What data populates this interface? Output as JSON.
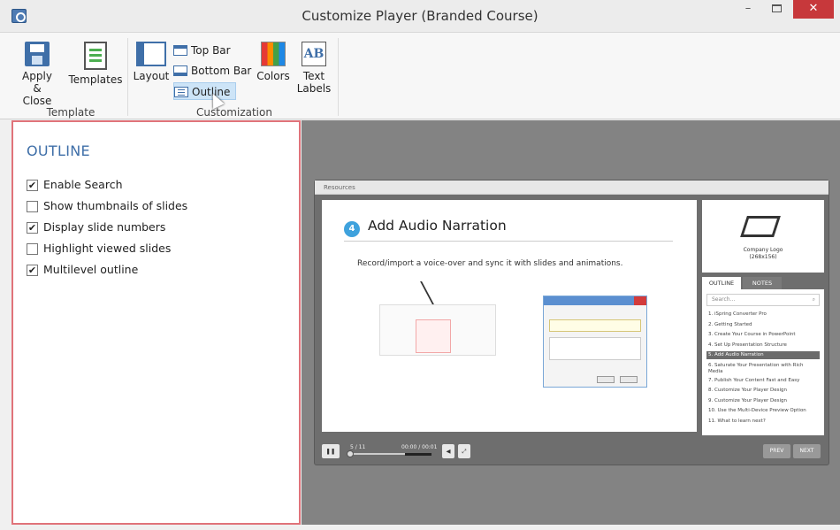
{
  "window": {
    "title": "Customize Player (Branded Course)",
    "minimize_glyph": "–",
    "close_glyph": "✕"
  },
  "ribbon": {
    "apply_close_label": "Apply\n& Close",
    "templates_label": "Templates",
    "layout_label": "Layout",
    "top_bar_label": "Top Bar",
    "bottom_bar_label": "Bottom Bar",
    "outline_label": "Outline",
    "colors_label": "Colors",
    "text_labels_label": "Text\nLabels",
    "text_labels_icon_text": "AB",
    "group_template": "Template",
    "group_customization": "Customization"
  },
  "panel": {
    "title": "OUTLINE",
    "options": [
      {
        "label": "Enable Search",
        "checked": true
      },
      {
        "label": "Show thumbnails of slides",
        "checked": false
      },
      {
        "label": "Display slide numbers",
        "checked": true
      },
      {
        "label": "Highlight viewed slides",
        "checked": false
      },
      {
        "label": "Multilevel outline",
        "checked": true
      }
    ]
  },
  "preview": {
    "top_bar_text": "Resources",
    "slide": {
      "number": "4",
      "title": "Add Audio Narration",
      "subtitle": "Record/import a voice-over and sync it with slides and animations."
    },
    "logo": {
      "text_line1": "Company Logo",
      "text_line2": "(268x156)"
    },
    "tabs": {
      "outline": "OUTLINE",
      "notes": "NOTES"
    },
    "search_placeholder": "Search...",
    "outline_items": [
      "1. iSpring Converter Pro",
      "2. Getting Started",
      "3. Create Your Course in PowerPoint",
      "4. Set Up Presentation Structure",
      "5. Add Audio Narration",
      "6. Saturate Your Presentation with Rich Media",
      "7. Publish Your Content Fast and Easy",
      "8. Customize Your Player Design",
      "9. Customize Your Player Design",
      "10. Use the Multi-Device Preview Option",
      "11. What to learn next?"
    ],
    "active_item_index": 4,
    "controls": {
      "slide_count": "5 / 11",
      "time": "00:00 / 00:01",
      "prev": "PREV",
      "next": "NEXT"
    }
  }
}
